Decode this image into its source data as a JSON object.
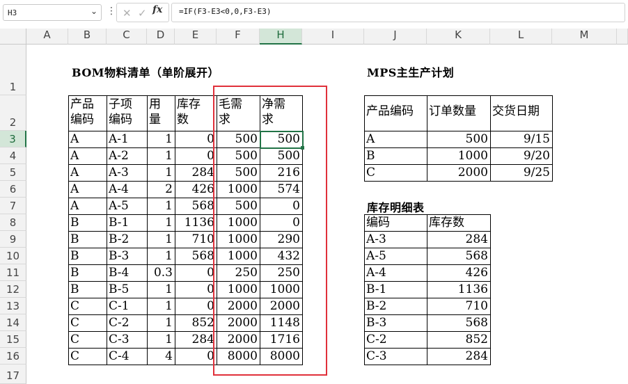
{
  "formula_bar": {
    "name_box": "H3",
    "formula": "=IF(F3-E3<0,0,F3-E3)",
    "fx_label": "fx",
    "icons": [
      "chevron-down-icon",
      "more-dots-icon",
      "cancel-icon",
      "confirm-icon"
    ]
  },
  "columns": [
    "A",
    "B",
    "C",
    "D",
    "E",
    "F",
    "H",
    "I",
    "J",
    "K",
    "L",
    "M"
  ],
  "rows": [
    "1",
    "2",
    "3",
    "4",
    "5",
    "6",
    "7",
    "8",
    "9",
    "10",
    "11",
    "12",
    "13",
    "14",
    "15",
    "16",
    "17"
  ],
  "selection": {
    "column": "H",
    "row": "3"
  },
  "highlight_color": "#e0303a",
  "bom": {
    "title": "BOM物料清单（单阶展开）",
    "headers": [
      [
        "产品",
        "编码"
      ],
      [
        "子项",
        "编码"
      ],
      [
        "用",
        "量"
      ],
      [
        "库存",
        "数"
      ],
      [
        "毛需",
        "求"
      ],
      [
        "净需",
        "求"
      ]
    ],
    "rows": [
      [
        "A",
        "A-1",
        "1",
        "0",
        "500",
        "500"
      ],
      [
        "A",
        "A-2",
        "1",
        "0",
        "500",
        "500"
      ],
      [
        "A",
        "A-3",
        "1",
        "284",
        "500",
        "216"
      ],
      [
        "A",
        "A-4",
        "2",
        "426",
        "1000",
        "574"
      ],
      [
        "A",
        "A-5",
        "1",
        "568",
        "500",
        "0"
      ],
      [
        "B",
        "B-1",
        "1",
        "1136",
        "1000",
        "0"
      ],
      [
        "B",
        "B-2",
        "1",
        "710",
        "1000",
        "290"
      ],
      [
        "B",
        "B-3",
        "1",
        "568",
        "1000",
        "432"
      ],
      [
        "B",
        "B-4",
        "0.3",
        "0",
        "250",
        "250"
      ],
      [
        "B",
        "B-5",
        "1",
        "0",
        "1000",
        "1000"
      ],
      [
        "C",
        "C-1",
        "1",
        "0",
        "2000",
        "2000"
      ],
      [
        "C",
        "C-2",
        "1",
        "852",
        "2000",
        "1148"
      ],
      [
        "C",
        "C-3",
        "1",
        "284",
        "2000",
        "1716"
      ],
      [
        "C",
        "C-4",
        "4",
        "0",
        "8000",
        "8000"
      ]
    ]
  },
  "mps": {
    "title": "MPS主生产计划",
    "headers": [
      "产品编码",
      "订单数量",
      "交货日期"
    ],
    "rows": [
      [
        "A",
        "500",
        "9/15"
      ],
      [
        "B",
        "1000",
        "9/20"
      ],
      [
        "C",
        "2000",
        "9/25"
      ]
    ]
  },
  "stock": {
    "title": "库存明细表",
    "headers": [
      "编码",
      "库存数"
    ],
    "rows": [
      [
        "A-3",
        "284"
      ],
      [
        "A-5",
        "568"
      ],
      [
        "A-4",
        "426"
      ],
      [
        "B-1",
        "1136"
      ],
      [
        "B-2",
        "710"
      ],
      [
        "B-3",
        "568"
      ],
      [
        "C-2",
        "852"
      ],
      [
        "C-3",
        "284"
      ]
    ]
  }
}
